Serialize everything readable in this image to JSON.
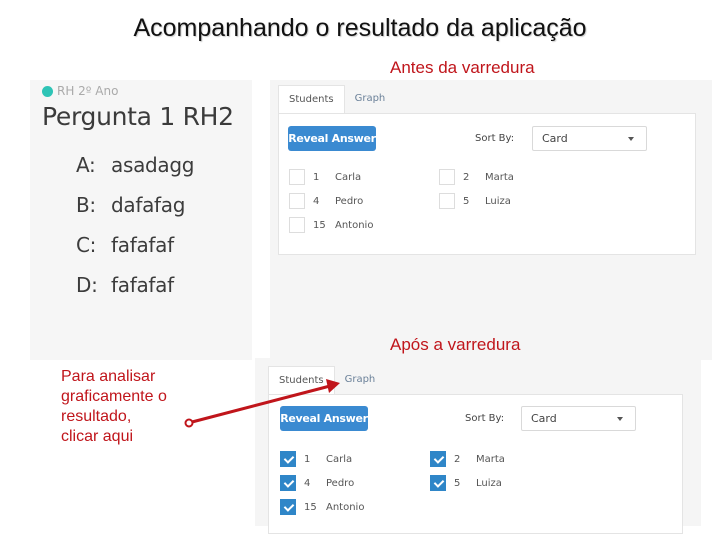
{
  "slide": {
    "title": "Acompanhando o resultado da aplicação",
    "caption_before": "Antes da varredura",
    "caption_after": "Após a varredura",
    "note": [
      "Para analisar",
      "graficamente o",
      "resultado,",
      "clicar aqui"
    ],
    "accent_color": "#c0151b"
  },
  "question": {
    "class_label": "RH 2º Ano",
    "class_dot_color": "#2ec4b6",
    "title": "Pergunta 1 RH2",
    "options": [
      {
        "letter": "A:",
        "text": "asadagg"
      },
      {
        "letter": "B:",
        "text": "dafafag"
      },
      {
        "letter": "C:",
        "text": "fafafaf"
      },
      {
        "letter": "D:",
        "text": "fafafaf"
      }
    ]
  },
  "before": {
    "tabs": [
      {
        "label": "Students",
        "active": true
      },
      {
        "label": "Graph",
        "active": false
      }
    ],
    "reveal_label": "Reveal Answer",
    "sort_label": "Sort By:",
    "sort_value": "Card",
    "students": [
      {
        "num": "1",
        "name": "Carla",
        "checked": false
      },
      {
        "num": "4",
        "name": "Pedro",
        "checked": false
      },
      {
        "num": "15",
        "name": "Antonio",
        "checked": false
      },
      {
        "num": "2",
        "name": "Marta",
        "checked": false
      },
      {
        "num": "5",
        "name": "Luiza",
        "checked": false
      }
    ]
  },
  "after": {
    "tabs": [
      {
        "label": "Students",
        "active": true
      },
      {
        "label": "Graph",
        "active": false
      }
    ],
    "reveal_label": "Reveal Answer",
    "sort_label": "Sort By:",
    "sort_value": "Card",
    "students": [
      {
        "num": "1",
        "name": "Carla",
        "checked": true
      },
      {
        "num": "4",
        "name": "Pedro",
        "checked": true
      },
      {
        "num": "15",
        "name": "Antonio",
        "checked": true
      },
      {
        "num": "2",
        "name": "Marta",
        "checked": true
      },
      {
        "num": "5",
        "name": "Luiza",
        "checked": true
      }
    ]
  }
}
